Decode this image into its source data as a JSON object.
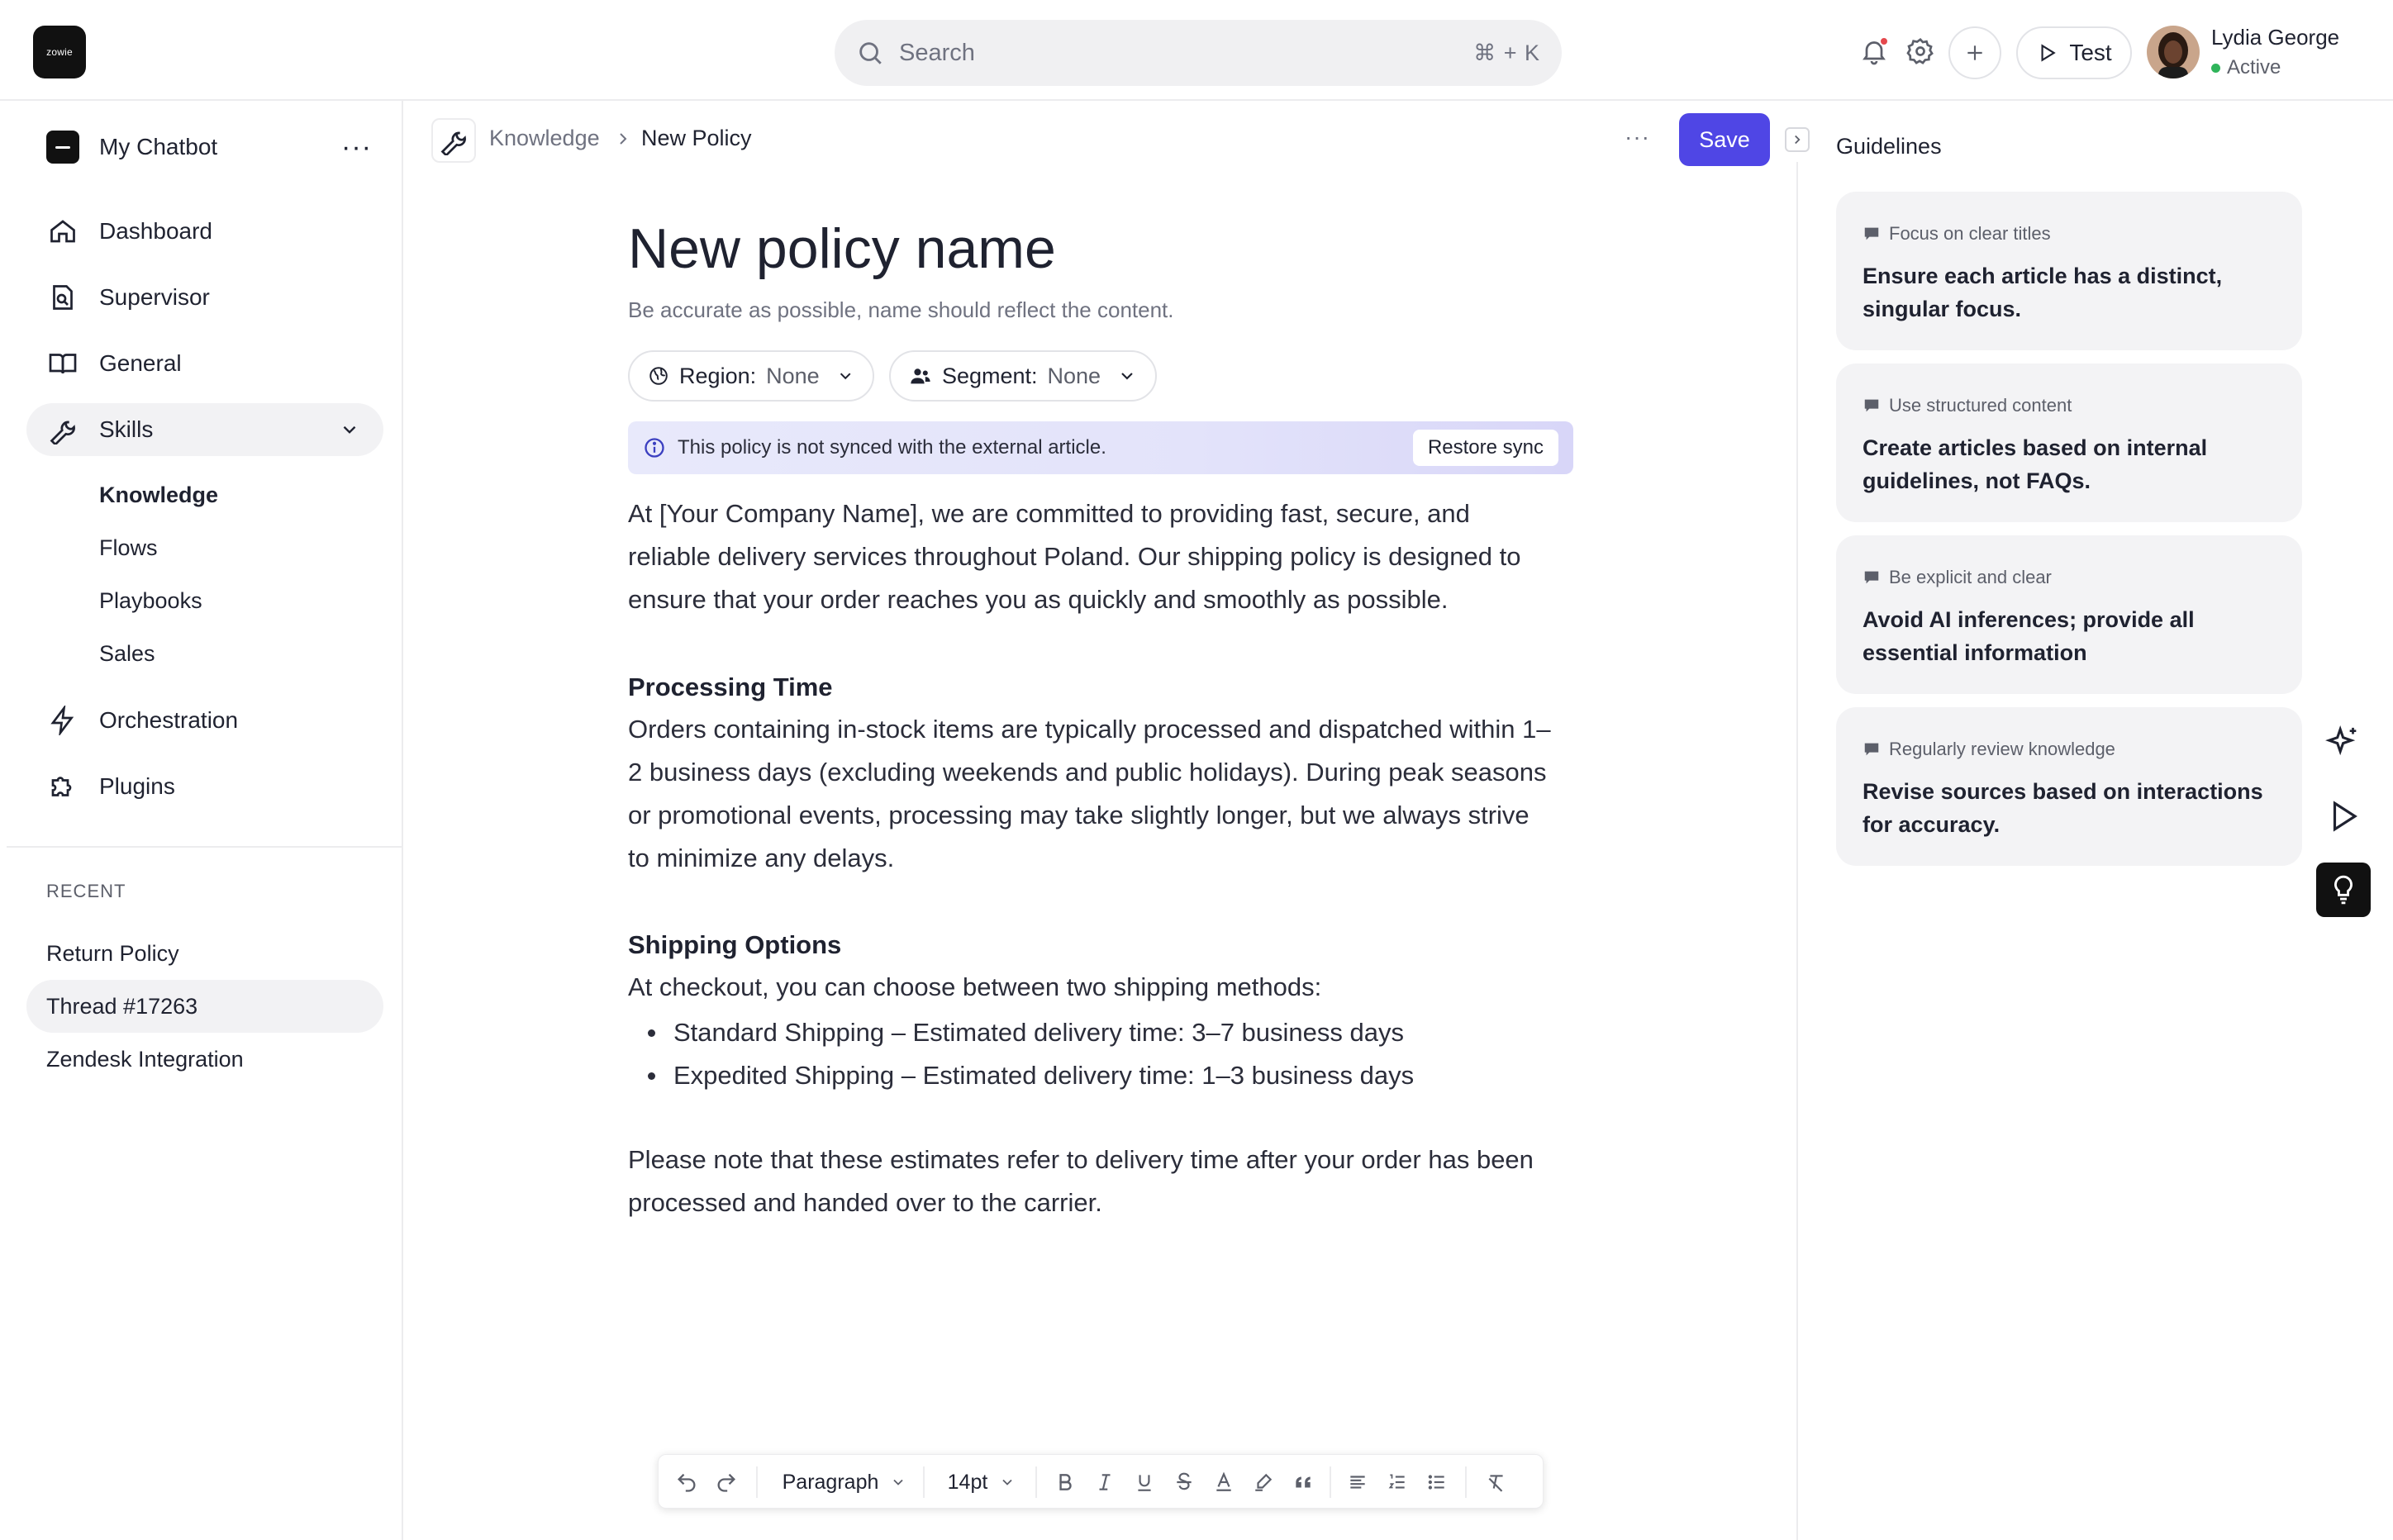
{
  "app": {
    "logo_text": "zowie",
    "search_placeholder": "Search",
    "search_shortcut": "⌘ + K",
    "test_label": "Test",
    "user_name": "Lydia George",
    "user_status": "Active"
  },
  "sidebar": {
    "bot_name": "My Chatbot",
    "nav": [
      {
        "label": "Dashboard",
        "icon": "home-icon"
      },
      {
        "label": "Supervisor",
        "icon": "supervisor-icon"
      },
      {
        "label": "General",
        "icon": "book-icon"
      },
      {
        "label": "Skills",
        "icon": "wrench-icon"
      },
      {
        "label": "Orchestration",
        "icon": "bolt-icon"
      },
      {
        "label": "Plugins",
        "icon": "puzzle-icon"
      }
    ],
    "skills_sub": [
      "Knowledge",
      "Flows",
      "Playbooks",
      "Sales"
    ],
    "recent_label": "RECENT",
    "recent": [
      "Return Policy",
      "Thread #17263",
      "Zendesk Integration"
    ]
  },
  "header": {
    "crumb_parent": "Knowledge",
    "crumb_current": "New Policy",
    "more": "···",
    "save_label": "Save"
  },
  "editor": {
    "title": "New policy name",
    "subtitle": "Be accurate as possible, name should reflect the content.",
    "region_label": "Region:",
    "region_value": "None",
    "segment_label": "Segment:",
    "segment_value": "None",
    "sync_message": "This policy is not synced with the external article.",
    "restore_label": "Restore sync",
    "intro_lines": [
      "At [Your Company Name], we are committed to providing fast, secure, and",
      "reliable delivery services throughout Poland. Our shipping policy is designed to",
      "ensure that your order reaches you as quickly and smoothly as possible."
    ],
    "processing_heading": "Processing Time",
    "processing_lines": [
      "Orders containing in-stock items are typically processed and dispatched within 1–",
      "2 business days (excluding weekends and public holidays). During peak seasons",
      "or promotional events, processing may take slightly longer, but we always strive",
      "to minimize any delays."
    ],
    "shipping_heading": "Shipping Options",
    "shipping_intro": "At checkout, you can choose between two shipping methods:",
    "shipping_bullets": [
      "Standard Shipping – Estimated delivery time: 3–7 business days",
      "Expedited Shipping – Estimated delivery time: 1–3 business days"
    ],
    "note_lines": [
      "Please note that these estimates refer to delivery time after your order has been",
      "processed and handed over to the carrier."
    ]
  },
  "toolbar": {
    "block_style": "Paragraph",
    "font_size": "14pt"
  },
  "guidelines": {
    "title": "Guidelines",
    "cards": [
      {
        "tag": "Focus on clear titles",
        "text_lines": [
          "Ensure each article has a distinct,",
          "singular focus."
        ]
      },
      {
        "tag": "Use structured content",
        "text_lines": [
          "Create articles based on internal",
          "guidelines, not FAQs."
        ]
      },
      {
        "tag": "Be explicit and clear",
        "text_lines": [
          "Avoid AI inferences; provide all",
          "essential information"
        ]
      },
      {
        "tag": "Regularly review knowledge",
        "text_lines": [
          "Revise sources based on interactions",
          "for accuracy."
        ]
      }
    ]
  },
  "colors": {
    "accent": "#4f46e5",
    "status_active": "#2fb45a",
    "notification": "#e5484d"
  }
}
